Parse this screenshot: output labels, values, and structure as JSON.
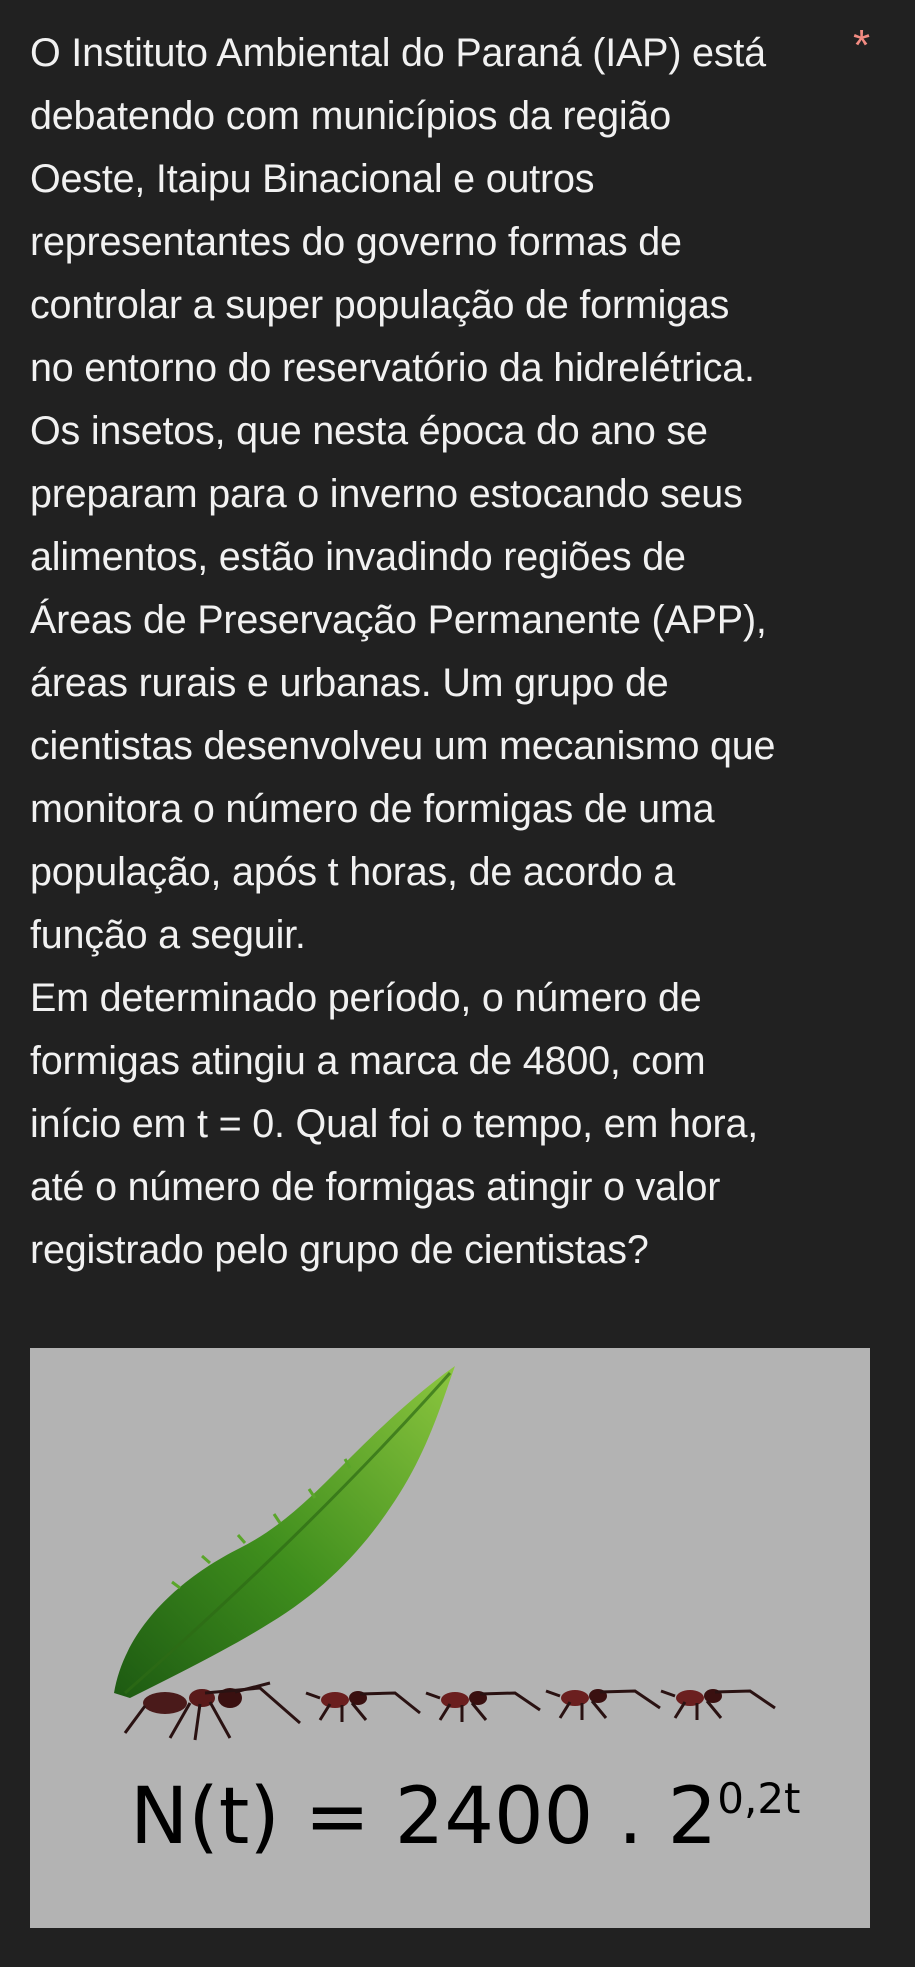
{
  "question": {
    "lines": [
      "O Instituto Ambiental do Paraná (IAP) está",
      "debatendo com municípios da região",
      "Oeste, Itaipu Binacional e outros",
      "representantes do governo formas de",
      "controlar a super população de formigas",
      "no entorno do reservatório da hidrelétrica.",
      "Os insetos, que nesta época do ano se",
      "preparam para o inverno estocando seus",
      "alimentos, estão invadindo regiões de",
      "Áreas de Preservação Permanente (APP),",
      "áreas rurais e urbanas. Um grupo de",
      "cientistas desenvolveu um mecanismo que",
      "monitora o número de formigas de uma",
      "população, após t horas, de acordo a",
      "função a seguir.",
      "Em determinado período, o número de",
      "formigas atingiu a marca de 4800, com",
      "início em t = 0. Qual foi o tempo, em hora,",
      "até o número de formigas atingir o valor",
      "registrado pelo grupo de cientistas?"
    ],
    "required_mark": "*"
  },
  "figure": {
    "formula_base": "N(t) = 2400 . 2",
    "formula_exponent": "0,2t"
  },
  "colors": {
    "background": "#212121",
    "text": "#f1f1f1",
    "required": "#f28b82",
    "image_background": "#b3b3b3",
    "leaf": "#4e9a1f"
  }
}
